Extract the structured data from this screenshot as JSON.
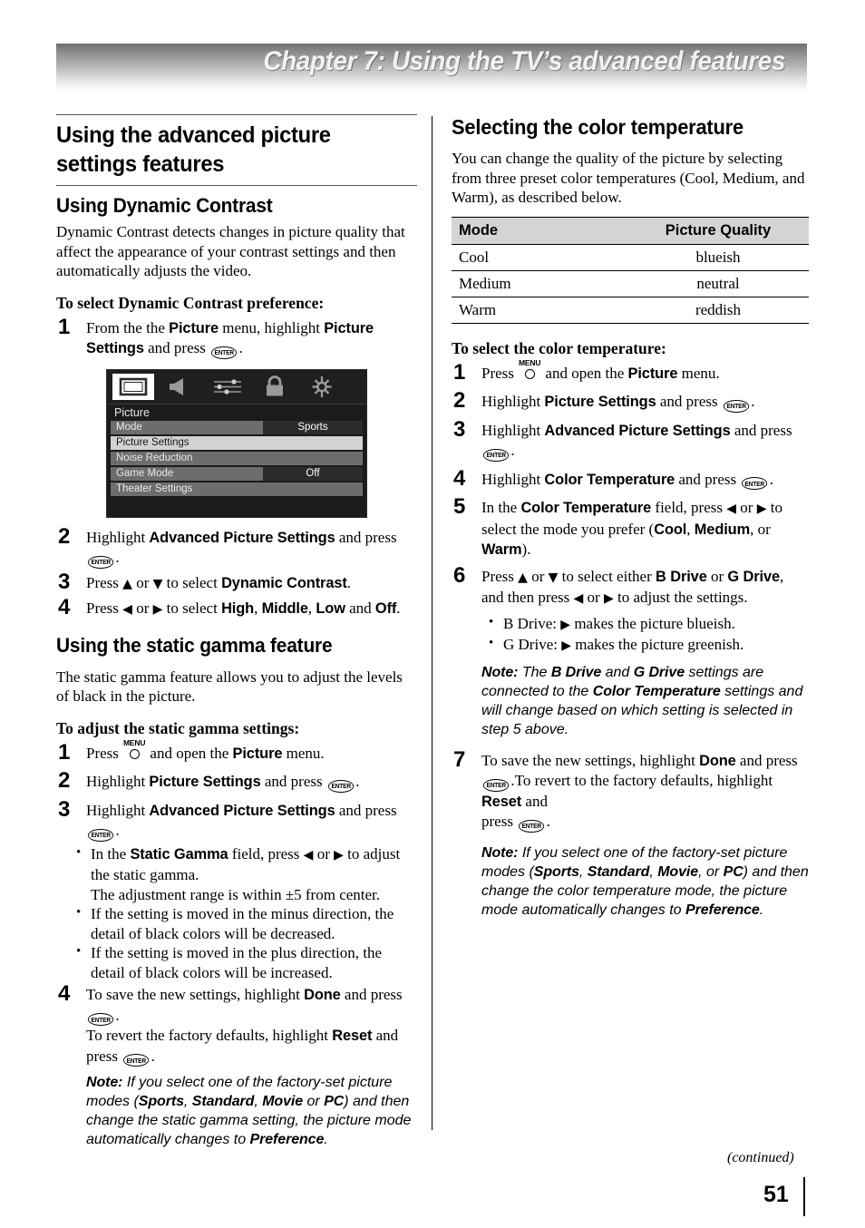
{
  "header": {
    "chapter_title": "Chapter 7: Using the TV’s advanced features"
  },
  "left_column": {
    "section_heading": "Using the advanced picture settings features",
    "dynamic_contrast": {
      "heading": "Using Dynamic Contrast",
      "body": "Dynamic Contrast detects changes in picture quality that affect the appearance of your contrast settings and then automatically adjusts the video.",
      "procedure_title": "To select Dynamic Contrast preference:",
      "steps": [
        {
          "num": "1",
          "text_1": "From the the ",
          "b1": "Picture",
          "text_2": " menu, highlight ",
          "b2": "Picture Settings",
          "text_3": " and press ",
          "icon": "enter-icon",
          "text_4": "."
        },
        {
          "num": "2",
          "text_1": "Highlight ",
          "b1": "Advanced Picture Settings",
          "text_2": " and press ",
          "icon": "enter-icon",
          "text_3": "."
        },
        {
          "num": "3",
          "text_1": "Press ",
          "arrow_up": "▲",
          "text_2": " or ",
          "arrow_down": "▼",
          "text_3": " to select ",
          "b1": "Dynamic Contrast",
          "text_4": "."
        },
        {
          "num": "4",
          "text_1": "Press ",
          "arrow_left": "◀",
          "text_2": " or ",
          "arrow_right": "▶",
          "text_3": " to select ",
          "b1": "High",
          "text_4": ", ",
          "b2": "Middle",
          "text_5": ", ",
          "b3": "Low",
          "text_6": " and ",
          "b4": "Off",
          "text_7": "."
        }
      ]
    },
    "tv_menu": {
      "icons": [
        "picture-icon",
        "audio-icon",
        "settings-icon",
        "lock-icon",
        "setup-icon"
      ],
      "selected_icon_index": 0,
      "menu_title": "Picture",
      "rows": [
        {
          "label": "Mode",
          "value": "Sports",
          "highlighted": false,
          "split": true
        },
        {
          "label": "Picture Settings",
          "value": "",
          "highlighted": true,
          "split": false
        },
        {
          "label": "Noise Reduction",
          "value": "",
          "highlighted": false,
          "split": false
        },
        {
          "label": "Game Mode",
          "value": "Off",
          "highlighted": false,
          "split": true
        },
        {
          "label": "Theater Settings",
          "value": "",
          "highlighted": false,
          "split": false
        }
      ]
    },
    "static_gamma": {
      "heading": "Using the static gamma feature",
      "body": "The static gamma feature allows you to adjust the levels of black in the picture.",
      "procedure_title": "To adjust the static gamma settings:",
      "step1": {
        "num": "1",
        "text_1": "Press ",
        "icon": "menu-icon",
        "icon_label": "MENU",
        "text_2": " and open the ",
        "b1": "Picture",
        "text_3": " menu."
      },
      "step2": {
        "num": "2",
        "text_1": "Highlight ",
        "b1": "Picture Settings",
        "text_2": " and press ",
        "icon": "enter-icon",
        "text_3": "."
      },
      "step3": {
        "num": "3",
        "text_1": "Highlight ",
        "b1": "Advanced Picture Settings",
        "text_2": " and press ",
        "icon": "enter-icon",
        "text_3": "."
      },
      "bullets": [
        {
          "text_1": "In the ",
          "b1": "Static Gamma",
          "text_2": " field, press ",
          "arrow_left": "◀",
          "text_3": " or ",
          "arrow_right": "▶",
          "text_4": " to adjust the static gamma.",
          "extra_line": "The adjustment range is within ±5 from center."
        },
        {
          "text_1": "If the setting is moved in the minus direction, the detail of black colors will be decreased."
        },
        {
          "text_1": "If the setting is moved in the plus direction, the detail of black colors will be increased."
        }
      ],
      "step4": {
        "num": "4",
        "text_1": "To save the new settings, highlight ",
        "b1": "Done",
        "text_2": " and press ",
        "icon": "enter-icon",
        "text_3": ".",
        "line2_1": "To revert the factory defaults, highlight ",
        "line2_b": "Reset",
        "line2_2": " and press ",
        "line2_3": "."
      },
      "note": {
        "label": "Note:",
        "text_1": " If you select one of the factory-set picture modes (",
        "b1": "Sports",
        "text_2": ", ",
        "b2": "Standard",
        "text_3": ", ",
        "b3": "Movie",
        "text_4": " or ",
        "b4": "PC",
        "text_5": ") and then change the static gamma setting, the picture mode automatically changes to ",
        "b5": "Preference",
        "text_6": "."
      }
    }
  },
  "right_column": {
    "heading": "Selecting the color temperature",
    "body": "You can change the quality of the picture by selecting from three preset color temperatures (Cool, Medium, and Warm), as described below.",
    "table": {
      "columns": [
        "Mode",
        "Picture Quality"
      ],
      "rows": [
        [
          "Cool",
          "blueish"
        ],
        [
          "Medium",
          "neutral"
        ],
        [
          "Warm",
          "reddish"
        ]
      ]
    },
    "procedure_title": "To select the color temperature:",
    "step1": {
      "num": "1",
      "text_1": "Press ",
      "icon_label": "MENU",
      "text_2": " and open the ",
      "b1": "Picture",
      "text_3": " menu."
    },
    "step2": {
      "num": "2",
      "text_1": "Highlight ",
      "b1": "Picture Settings",
      "text_2": " and press ",
      "text_3": "."
    },
    "step3": {
      "num": "3",
      "text_1": "Highlight ",
      "b1": "Advanced Picture Settings",
      "text_2": " and press ",
      "text_3": "."
    },
    "step4": {
      "num": "4",
      "text_1": "Highlight ",
      "b1": "Color Temperature",
      "text_2": " and press ",
      "text_3": "."
    },
    "step5": {
      "num": "5",
      "text_1": "In the ",
      "b1": "Color Temperature",
      "text_2": " field, press ",
      "arrow_left": "◀",
      "text_3": " or ",
      "arrow_right": "▶",
      "text_4": " to select the mode you prefer (",
      "b2": "Cool",
      "text_5": ", ",
      "b3": "Medium",
      "text_6": ", or ",
      "b4": "Warm",
      "text_7": ")."
    },
    "step6": {
      "num": "6",
      "text_1": "Press ",
      "arrow_up": "▲",
      "text_2": " or ",
      "arrow_down": "▼",
      "text_3": " to select either ",
      "b1": "B Drive",
      "text_4": " or ",
      "b2": "G Drive",
      "text_5": ", and then press ",
      "arrow_left": "◀",
      "text_6": " or ",
      "arrow_right": "▶",
      "text_7": " to adjust the settings.",
      "bullets": [
        {
          "prefix": "B Drive: ",
          "arrow": "▶",
          "suffix": " makes the picture blueish."
        },
        {
          "prefix": "G Drive: ",
          "arrow": "▶",
          "suffix": " makes the picture greenish."
        }
      ],
      "note": {
        "label": "Note:",
        "text_1": " The ",
        "b1": "B Drive",
        "text_2": " and ",
        "b2": "G Drive",
        "text_3": " settings are connected to the ",
        "b3": "Color Temperature",
        "text_4": " settings and will change based on which setting is selected in step 5 above."
      }
    },
    "step7": {
      "num": "7",
      "text_1": "To save the new settings, highlight ",
      "b1": "Done",
      "text_2": " and press ",
      "text_3": ".",
      "line2_1": "To revert to the factory defaults, highlight ",
      "line2_b": "Reset",
      "line2_2": " and ",
      "line3_1": "press ",
      "line3_2": "."
    },
    "note": {
      "label": "Note:",
      "text_1": " If you select one of the factory-set picture modes (",
      "b1": "Sports",
      "text_2": ", ",
      "b2": "Standard",
      "text_3": ", ",
      "b3": "Movie",
      "text_4": ", or ",
      "b4": "PC",
      "text_5": ") and then change the color temperature mode, the picture mode automatically changes to ",
      "b5": "Preference",
      "text_6": "."
    }
  },
  "footer": {
    "continued": "(continued)",
    "page_number": "51"
  }
}
